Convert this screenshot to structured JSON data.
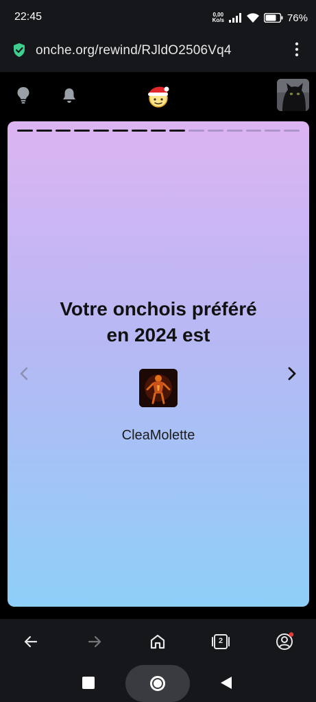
{
  "status_bar": {
    "time": "22:45",
    "net_speed_value": "0,00",
    "net_speed_unit": "Ko/s",
    "battery_percent": "76%",
    "battery_level": 0.76,
    "icons": [
      "signal-icon",
      "wifi-icon",
      "battery-icon"
    ]
  },
  "browser": {
    "url": "onche.org/rewind/RJldO2506Vq4",
    "secure_icon": "shield-check-icon",
    "menu_icon": "kebab-menu-icon",
    "tab_count": "2",
    "notification_dot_color": "#e53935"
  },
  "site_header": {
    "icons": [
      "lightbulb-icon",
      "bell-icon",
      "santa-smiley-logo",
      "user-avatar-cat"
    ]
  },
  "rewind_card": {
    "progress_total": 15,
    "progress_completed": 9,
    "title_line1": "Votre onchois préféré",
    "title_line2": "en 2024 est",
    "username": "CleaMolette",
    "gradient_top": "#dcb4f2",
    "gradient_bottom": "#8ecff8"
  },
  "bottom_bar": {
    "buttons": [
      "back-arrow-icon",
      "forward-arrow-icon",
      "home-icon",
      "tabs-icon",
      "account-icon"
    ]
  },
  "system_nav": {
    "buttons": [
      "recents-square-icon",
      "home-circle-icon",
      "back-triangle-icon"
    ]
  }
}
